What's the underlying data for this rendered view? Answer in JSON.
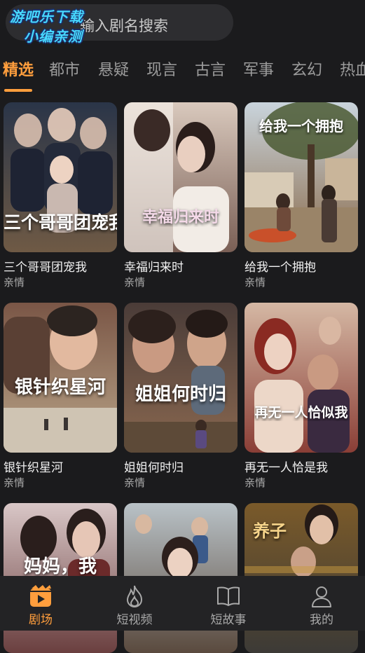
{
  "search": {
    "placeholder": "输入剧名搜索",
    "visible_text": "输入剧名搜索"
  },
  "watermark": {
    "line1": "游吧乐下载",
    "line2": "小编亲测"
  },
  "tabs": [
    {
      "label": "精选",
      "active": true
    },
    {
      "label": "都市"
    },
    {
      "label": "悬疑"
    },
    {
      "label": "现言"
    },
    {
      "label": "古言"
    },
    {
      "label": "军事"
    },
    {
      "label": "玄幻"
    },
    {
      "label": "热血"
    }
  ],
  "dramas": [
    {
      "title": "三个哥哥团宠我",
      "genre": "亲情",
      "poster_text": "三个哥哥团宠我",
      "colors": [
        "#2a3548",
        "#6f5a45"
      ]
    },
    {
      "title": "幸福归来时",
      "genre": "亲情",
      "poster_text": "幸福归来时",
      "colors": [
        "#d9c9bd",
        "#7a5f55"
      ]
    },
    {
      "title": "给我一个拥抱",
      "genre": "亲情",
      "poster_text": "给我一个拥抱",
      "colors": [
        "#c9d4dc",
        "#8a6a4a"
      ]
    },
    {
      "title": "银针织星河",
      "genre": "亲情",
      "poster_text": "银针织星河",
      "colors": [
        "#7a5646",
        "#b9a488"
      ]
    },
    {
      "title": "姐姐何时归",
      "genre": "亲情",
      "poster_text": "姐姐何时归",
      "colors": [
        "#4a3c38",
        "#8a6850"
      ]
    },
    {
      "title": "再无一人恰是我",
      "genre": "亲情",
      "poster_text": "再无一人恰似我",
      "colors": [
        "#d5b8a4",
        "#8a3e36"
      ]
    },
    {
      "title": "",
      "genre": "",
      "poster_text": "妈妈，我",
      "colors": [
        "#d9c7c7",
        "#6a3f3f"
      ]
    },
    {
      "title": "",
      "genre": "",
      "poster_text": "",
      "colors": [
        "#b9c2c7",
        "#5a4a3e"
      ]
    },
    {
      "title": "",
      "genre": "",
      "poster_text": "养子",
      "colors": [
        "#7a5a2a",
        "#3c3a36"
      ]
    }
  ],
  "bottom_nav": [
    {
      "label": "剧场",
      "icon": "clapperboard-icon",
      "active": true
    },
    {
      "label": "短视频",
      "icon": "flame-icon"
    },
    {
      "label": "短故事",
      "icon": "open-book-icon"
    },
    {
      "label": "我的",
      "icon": "person-icon"
    }
  ],
  "colors": {
    "accent": "#ff9e3d",
    "background": "#1b1b1d",
    "nav_background": "#232325"
  }
}
